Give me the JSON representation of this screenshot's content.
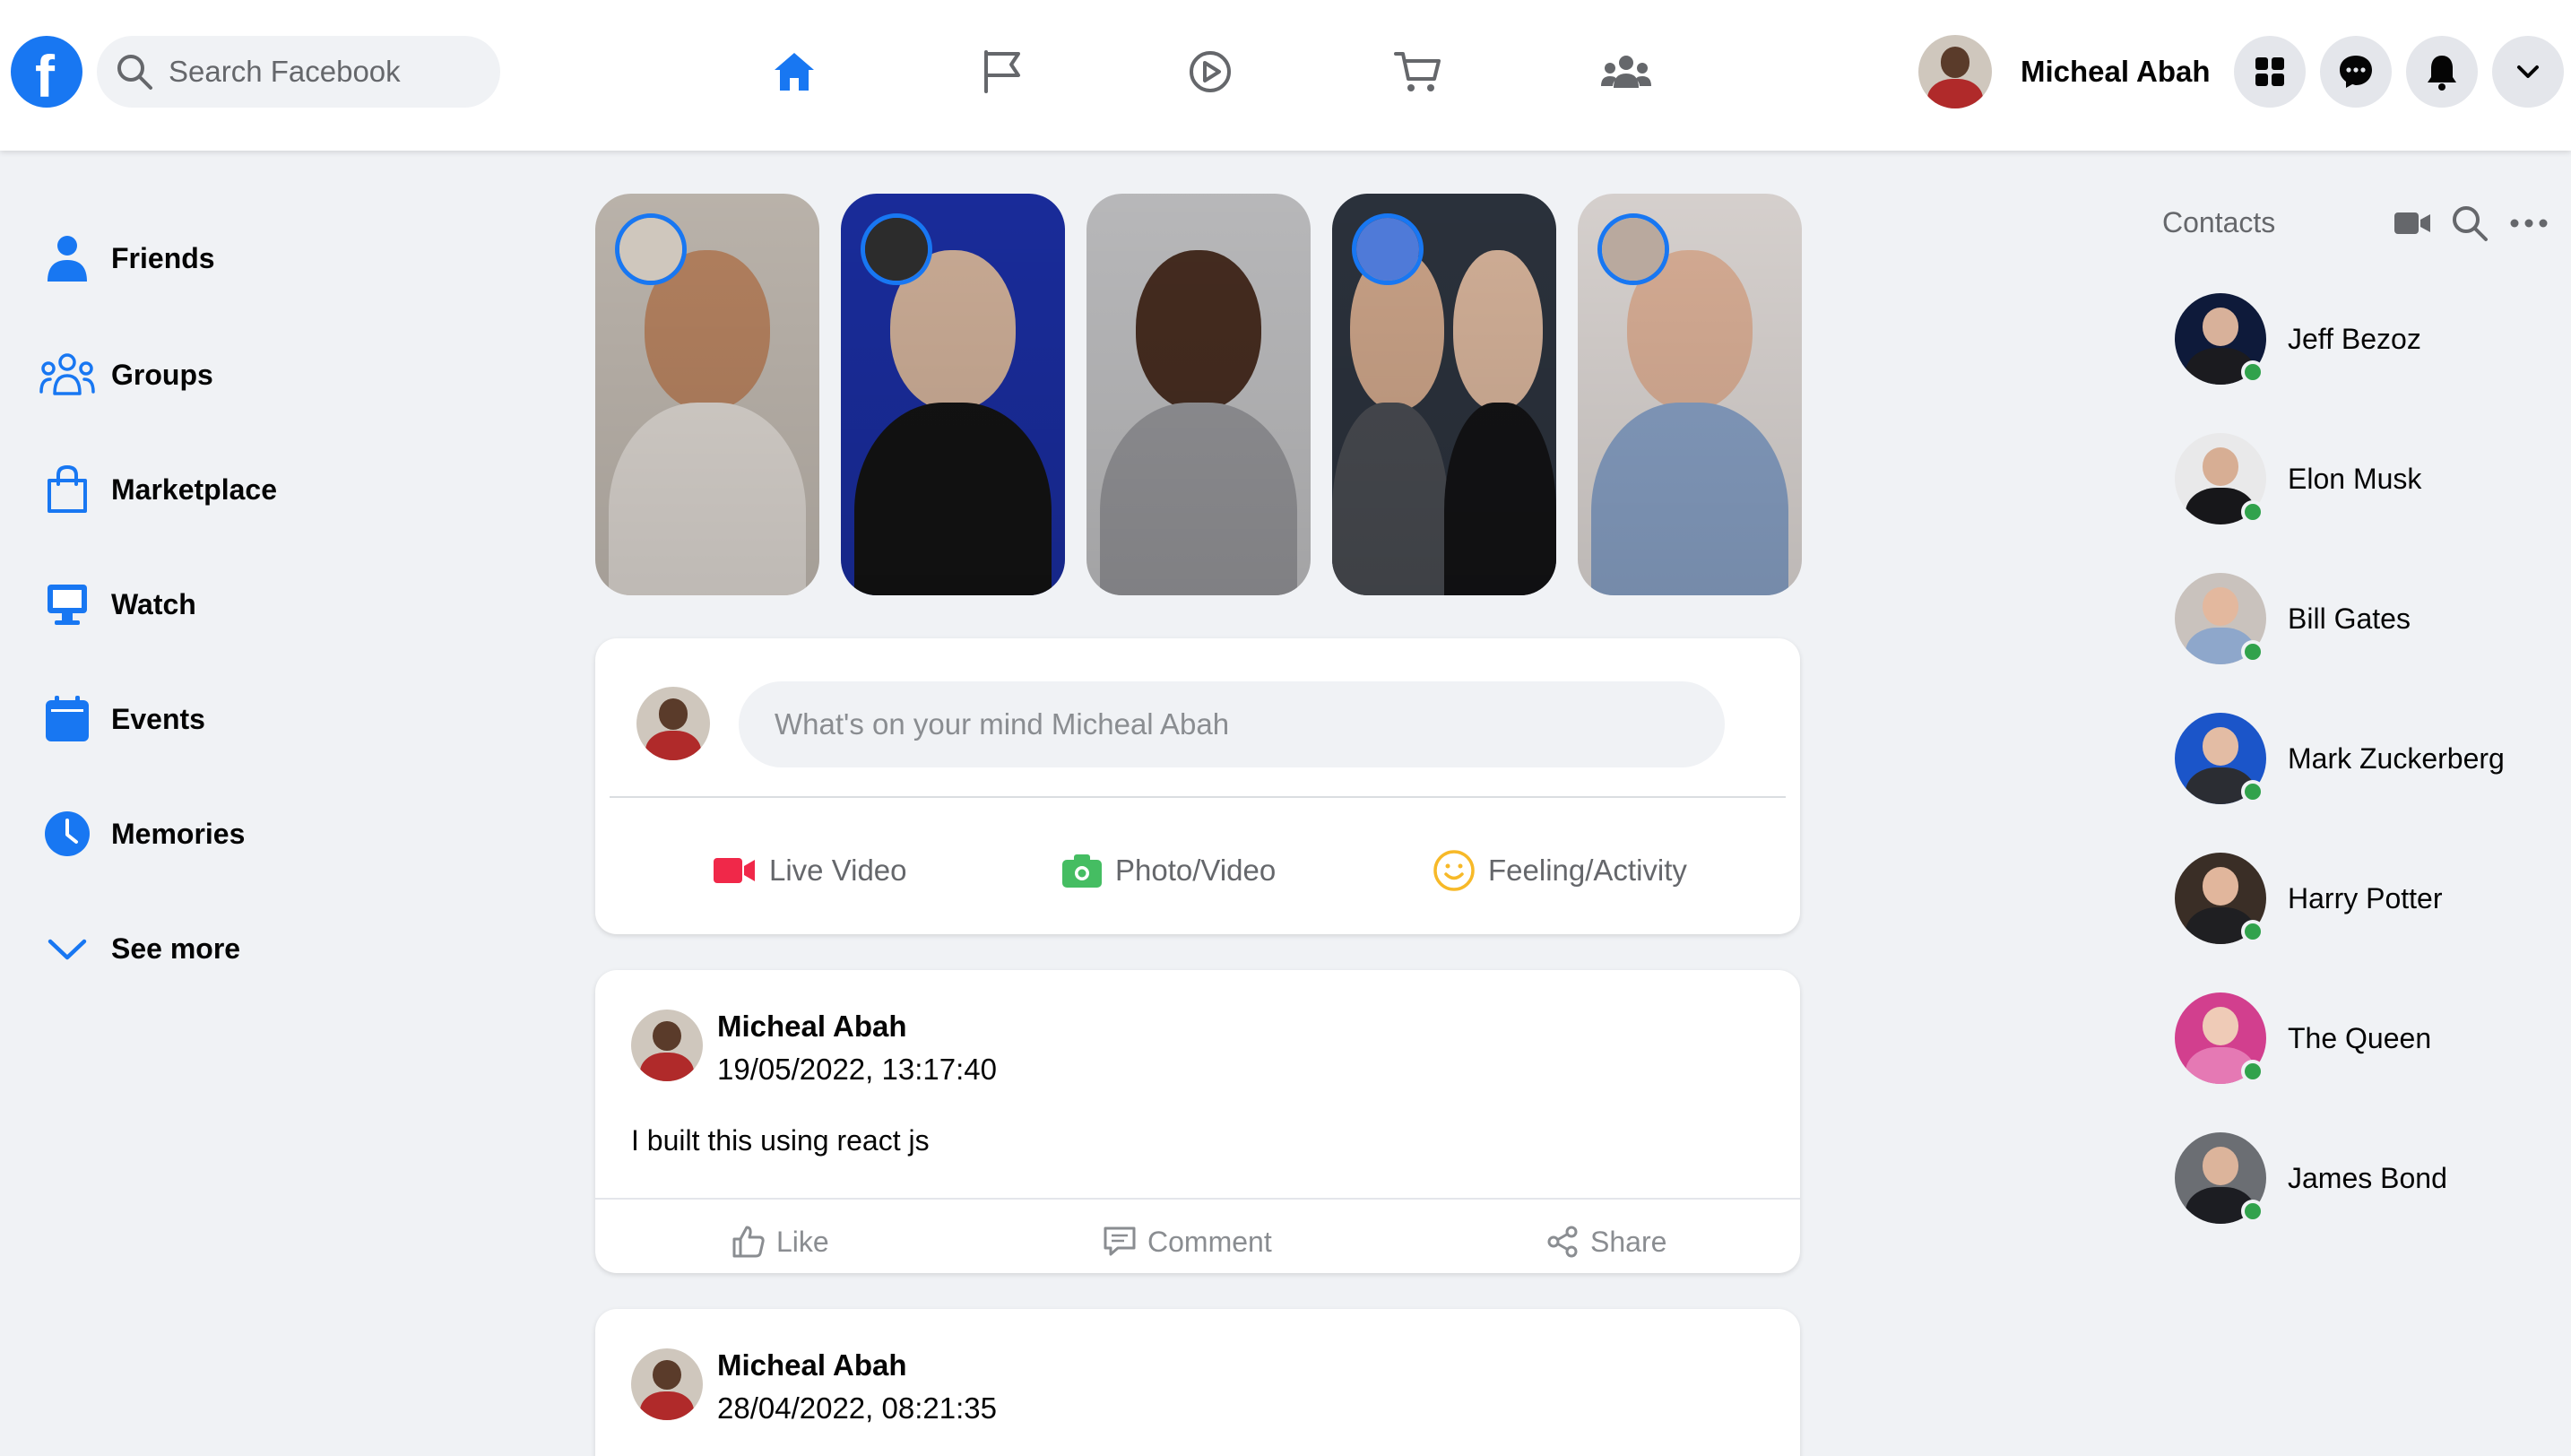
{
  "header": {
    "search_placeholder": "Search Facebook",
    "profile_name": "Micheal Abah",
    "brand_color": "#1877f2",
    "nav_icons": [
      "home-icon",
      "flag-icon",
      "video-play-icon",
      "cart-icon",
      "groups-icon"
    ],
    "action_icons": [
      "apps-grid-icon",
      "messenger-icon",
      "bell-icon",
      "chevron-down-icon"
    ]
  },
  "sidebar": {
    "items": [
      {
        "label": "Friends",
        "icon": "friends-icon"
      },
      {
        "label": "Groups",
        "icon": "groups-icon"
      },
      {
        "label": "Marketplace",
        "icon": "shopping-bag-icon"
      },
      {
        "label": "Watch",
        "icon": "monitor-icon"
      },
      {
        "label": "Events",
        "icon": "calendar-icon"
      },
      {
        "label": "Memories",
        "icon": "clock-icon"
      },
      {
        "label": "See more",
        "icon": "chevron-down-icon"
      }
    ]
  },
  "composer": {
    "placeholder": "What's on your mind Micheal Abah",
    "actions": [
      {
        "label": "Live Video",
        "icon": "live-video-icon",
        "color": "#f02849"
      },
      {
        "label": "Photo/Video",
        "icon": "camera-icon",
        "color": "#45bd62"
      },
      {
        "label": "Feeling/Activity",
        "icon": "smiley-icon",
        "color": "#f7b928"
      }
    ]
  },
  "posts": [
    {
      "author": "Micheal Abah",
      "timestamp": "19/05/2022, 13:17:40",
      "text": "I built this using react js",
      "actions": {
        "like": "Like",
        "comment": "Comment",
        "share": "Share"
      }
    },
    {
      "author": "Micheal Abah",
      "timestamp": "28/04/2022, 08:21:35"
    }
  ],
  "contacts": {
    "title": "Contacts",
    "tool_icons": [
      "video-camera-icon",
      "search-icon",
      "more-dots-icon"
    ],
    "online_color": "#31a24c",
    "people": [
      {
        "name": "Jeff Bezoz"
      },
      {
        "name": "Elon Musk"
      },
      {
        "name": "Bill Gates"
      },
      {
        "name": "Mark Zuckerberg"
      },
      {
        "name": "Harry Potter"
      },
      {
        "name": "The Queen"
      },
      {
        "name": "James Bond"
      }
    ]
  }
}
